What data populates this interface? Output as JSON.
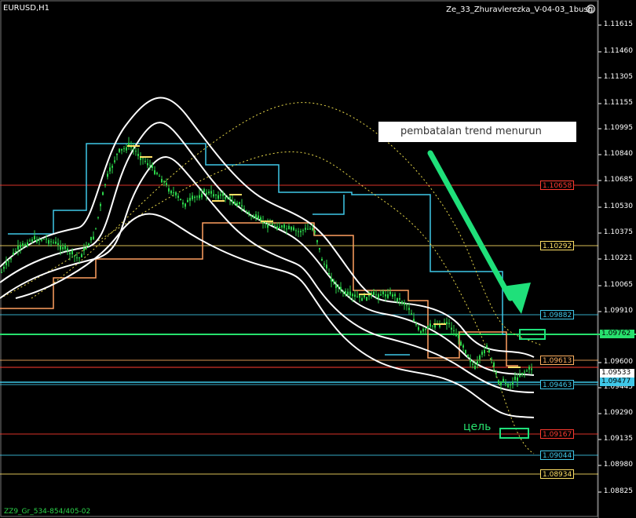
{
  "window": {
    "symbol": "EURUSD,H1",
    "indicator": "Ze_33_Zhuravlerezka_V-04-03_1bush",
    "footer": "ZZ9_Gr_534-854/405-02"
  },
  "price_axis": {
    "ticks": [
      "1.11615",
      "1.11460",
      "1.11305",
      "1.11155",
      "1.10995",
      "1.10840",
      "1.10685",
      "1.10530",
      "1.10375",
      "1.10221",
      "1.10065",
      "1.09910",
      "1.09600",
      "1.09445",
      "1.09290",
      "1.09135",
      "1.08980",
      "1.08825"
    ]
  },
  "levels": [
    {
      "label": "1.10658",
      "color": "#ff3b30",
      "kind": "red"
    },
    {
      "label": "1.10292",
      "color": "#ffe066",
      "kind": "yellow"
    },
    {
      "label": "1.09882",
      "color": "#3fc7e8",
      "kind": "cyan"
    },
    {
      "label": "1.09613",
      "color": "#ffb060",
      "kind": "orange"
    },
    {
      "label": "1.09463",
      "color": "#3fc7e8",
      "kind": "cyan"
    },
    {
      "label": "1.09167",
      "color": "#ff3b30",
      "kind": "red"
    },
    {
      "label": "1.09044",
      "color": "#3fc7e8",
      "kind": "cyan"
    },
    {
      "label": "1.08934",
      "color": "#ffe066",
      "kind": "yellow"
    }
  ],
  "price_tags": {
    "green": "1.09762",
    "current": "1.09533",
    "low": "1.09477"
  },
  "annotations": {
    "note": "pembatalan trend menurun",
    "target": "цель"
  },
  "colors": {
    "background": "#000000",
    "candles": "#2bd44a",
    "bands": "#ffffff",
    "annotation": "#27e06d"
  }
}
